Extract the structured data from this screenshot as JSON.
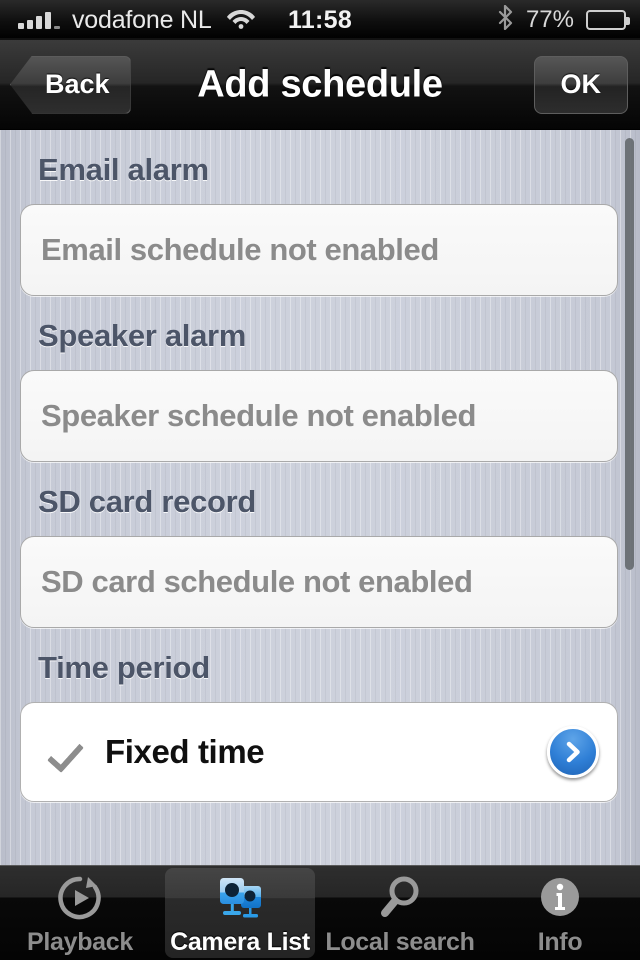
{
  "status_bar": {
    "carrier": "vodafone NL",
    "time": "11:58",
    "battery_percent": "77%",
    "battery_level": 77,
    "wifi_icon": "wifi-icon",
    "bluetooth_icon": "bluetooth-icon",
    "signal_icon": "signal-bars-icon",
    "battery_icon": "battery-icon"
  },
  "nav_bar": {
    "back_label": "Back",
    "title": "Add schedule",
    "ok_label": "OK"
  },
  "sections": [
    {
      "header": "Email alarm",
      "value": "Email schedule not enabled"
    },
    {
      "header": "Speaker alarm",
      "value": "Speaker schedule not enabled"
    },
    {
      "header": "SD card record",
      "value": "SD card schedule not enabled"
    }
  ],
  "time_period": {
    "header": "Time period",
    "row_label": "Fixed time",
    "checked": true,
    "check_icon": "checkmark-icon",
    "disclosure_icon": "chevron-right-icon"
  },
  "tab_bar": {
    "items": [
      {
        "label": "Playback",
        "icon": "playback-icon",
        "active": false
      },
      {
        "label": "Camera List",
        "icon": "camera-list-icon",
        "active": true
      },
      {
        "label": "Local search",
        "icon": "search-icon",
        "active": false
      },
      {
        "label": "Info",
        "icon": "info-icon",
        "active": false
      }
    ]
  },
  "colors": {
    "accent_blue": "#2f7fd6",
    "header_text": "#4c5568",
    "card_text": "#8b8b8b",
    "background": "#cdd1dc",
    "chrome_dark": "#111111"
  }
}
